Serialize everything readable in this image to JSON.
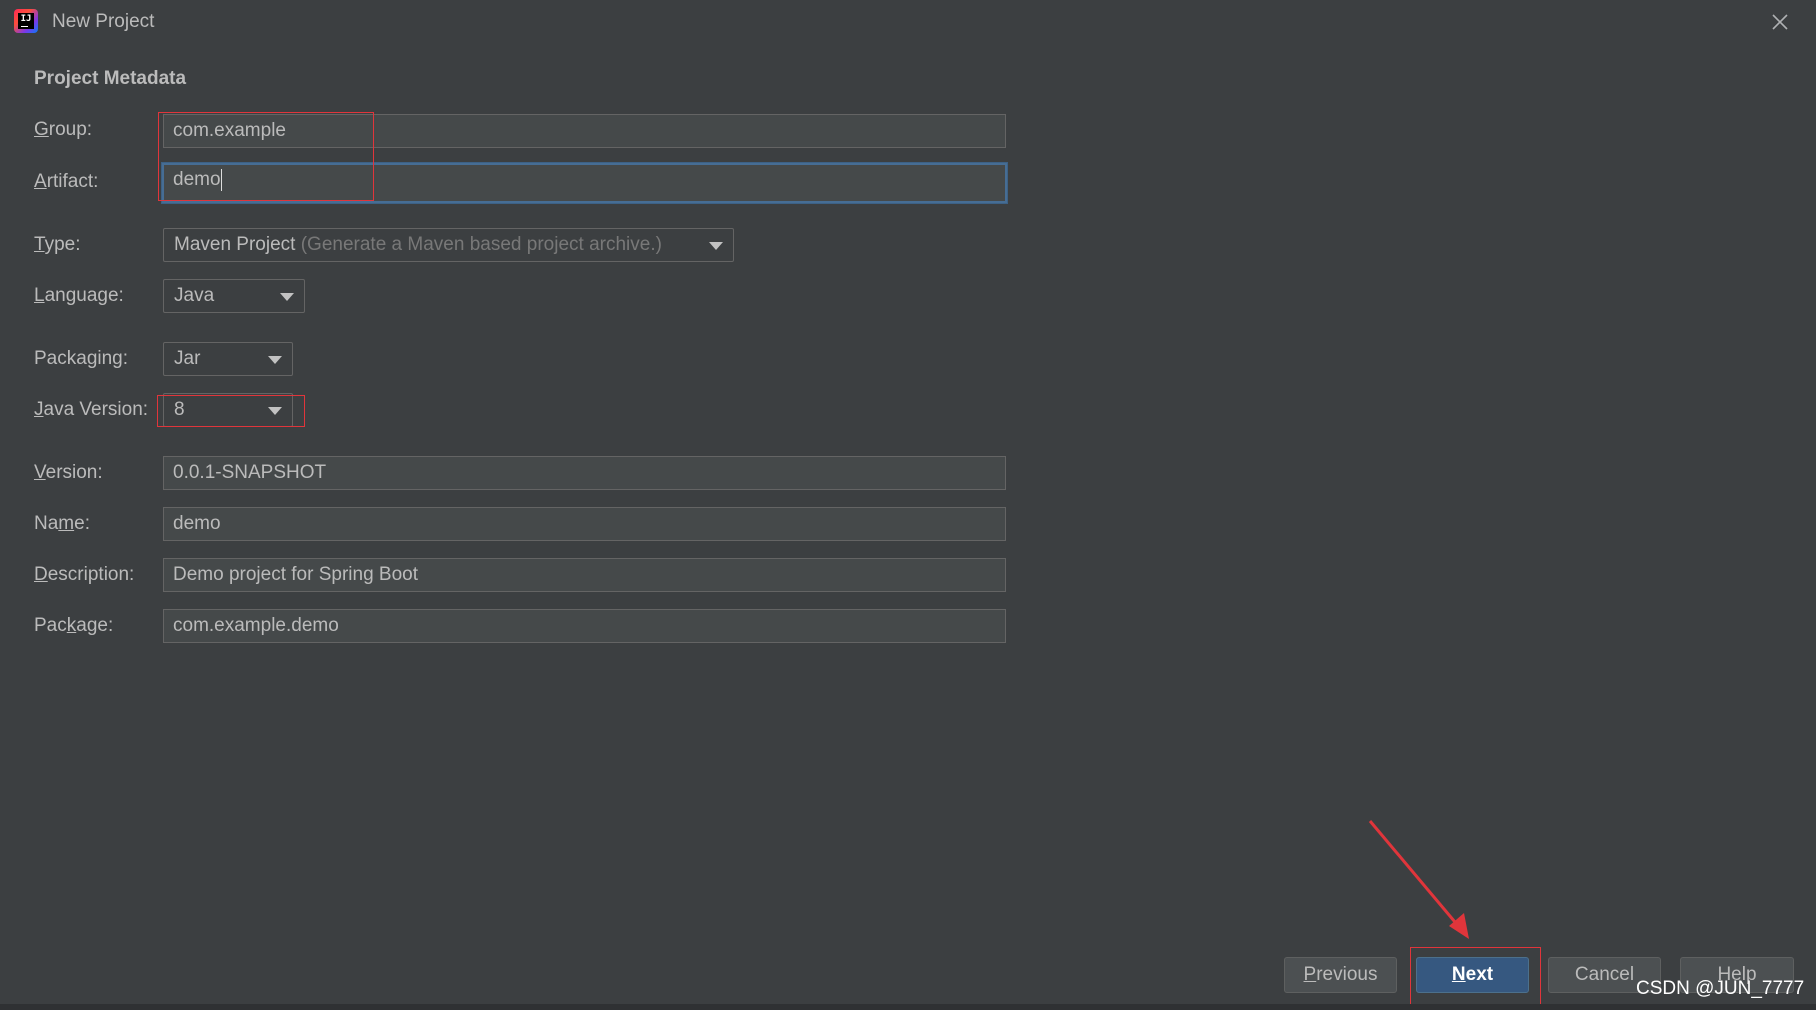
{
  "window": {
    "title": "New Project"
  },
  "section_title": "Project Metadata",
  "form": {
    "group": {
      "label_mn": "G",
      "label_rest": "roup:",
      "value": "com.example"
    },
    "artifact": {
      "label_mn": "A",
      "label_rest": "rtifact:",
      "value": "demo"
    },
    "type": {
      "label_mn": "T",
      "label_rest": "ype:",
      "value": "Maven Project",
      "hint": "(Generate a Maven based project archive.)"
    },
    "language": {
      "label_mn": "L",
      "label_rest": "anguage:",
      "value": "Java"
    },
    "packaging": {
      "label_pre": "Packa",
      "label_mn": "g",
      "label_rest": "ing:",
      "value": "Jar"
    },
    "java_version": {
      "label_mn": "J",
      "label_rest": "ava Version:",
      "value": "8"
    },
    "version": {
      "label_mn": "V",
      "label_rest": "ersion:",
      "value": "0.0.1-SNAPSHOT"
    },
    "name": {
      "label_pre": "Na",
      "label_mn": "m",
      "label_rest": "e:",
      "value": "demo"
    },
    "description": {
      "label_mn": "D",
      "label_rest": "escription:",
      "value": "Demo project for Spring Boot"
    },
    "package": {
      "label_pre": "Pac",
      "label_mn": "k",
      "label_rest": "age:",
      "value": "com.example.demo"
    }
  },
  "buttons": {
    "previous": {
      "mn": "P",
      "rest": "revious"
    },
    "next": {
      "mn": "N",
      "rest": "ext"
    },
    "cancel": {
      "label": "Cancel"
    },
    "help": {
      "label": "Help"
    }
  },
  "watermark": "CSDN @JUN_7777",
  "colors": {
    "background": "#3c3f41",
    "field_bg": "#45494a",
    "focus_border": "#466d94",
    "primary_button": "#365880",
    "annotation_red": "#e0353b"
  },
  "icons": {
    "app": "intellij-idea-icon",
    "close": "close-icon",
    "dropdown": "chevron-down-icon"
  }
}
